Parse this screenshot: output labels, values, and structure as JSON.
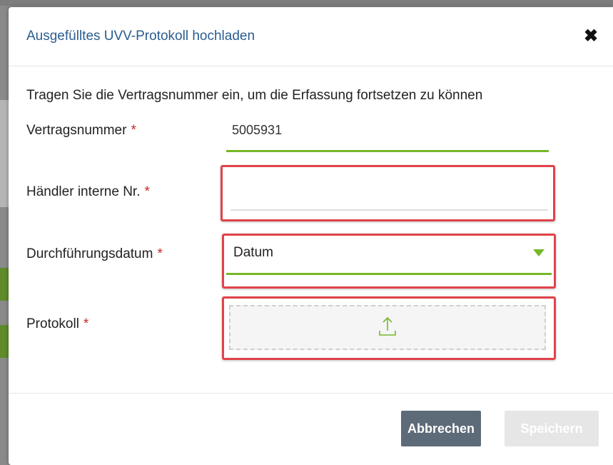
{
  "modal": {
    "title": "Ausgefülltes UVV-Protokoll hochladen",
    "close_symbol": "✖",
    "intro": "Tragen Sie die Vertragsnummer ein, um die Erfassung fortsetzen zu können",
    "required_marker": "*"
  },
  "form": {
    "contract_number": {
      "label": "Vertragsnummer",
      "value": "5005931"
    },
    "dealer_number": {
      "label": "Händler interne Nr.",
      "value": ""
    },
    "execution_date": {
      "label": "Durchführungsdatum",
      "value": "Datum"
    },
    "protocol": {
      "label": "Protokoll",
      "icon": "upload-icon"
    }
  },
  "footer": {
    "cancel_label": "Abbrechen",
    "save_label": "Speichern"
  },
  "colors": {
    "title": "#2a5d8f",
    "accent_green": "#76b82a",
    "required_red": "#c62828",
    "highlight_red": "#e0434a",
    "cancel_button": "#5d6a78",
    "save_button_disabled": "#e6e6e6"
  }
}
